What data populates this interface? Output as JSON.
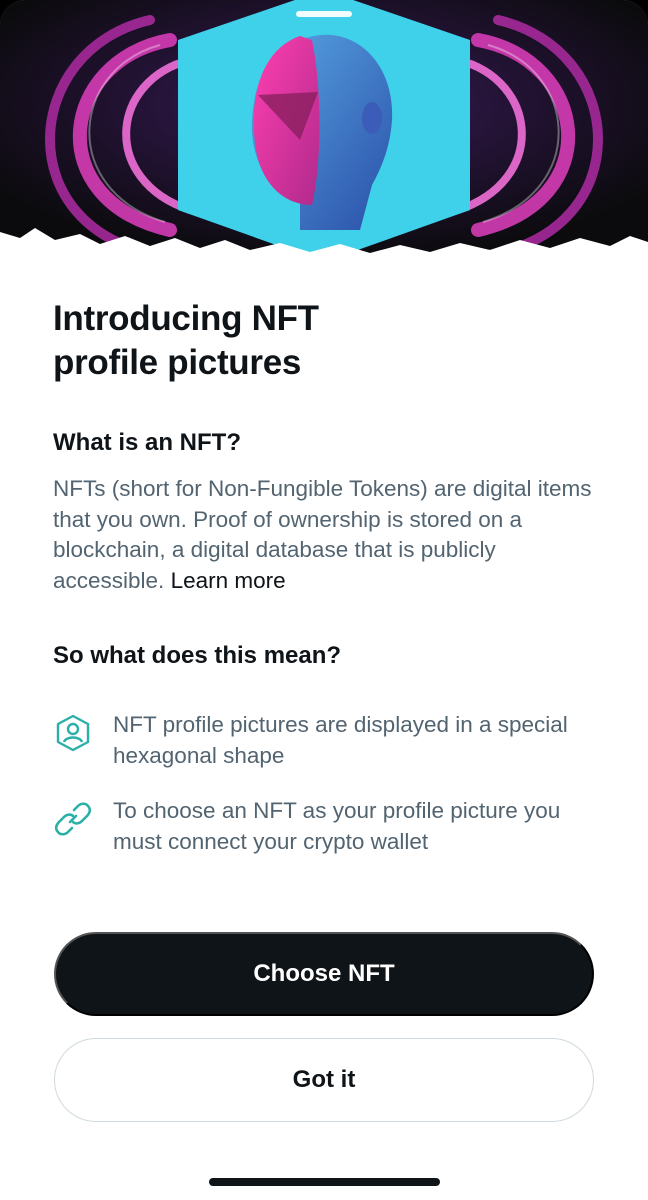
{
  "sheet": {
    "title_line1": "Introducing NFT",
    "title_line2": "profile pictures"
  },
  "what_section": {
    "heading": "What is an NFT?",
    "body": "NFTs (short for Non-Fungible Tokens) are digital items that you own. Proof of ownership is stored on a blockchain, a digital database that is publicly accessible. ",
    "link_label": "Learn more"
  },
  "mean_section": {
    "heading": "So what does this mean?",
    "items": [
      {
        "icon": "hexagon-profile-icon",
        "text": "NFT profile pictures are displayed in a special hexagonal shape"
      },
      {
        "icon": "link-icon",
        "text": "To choose an NFT as your profile picture you must connect your crypto wallet"
      }
    ]
  },
  "buttons": {
    "primary_label": "Choose NFT",
    "secondary_label": "Got it"
  },
  "colors": {
    "text_primary": "#0f1419",
    "text_secondary": "#536471",
    "icon_accent": "#1d9bf0",
    "hero_cyan": "#3fd1ea",
    "hero_magenta": "#d63cb6"
  }
}
